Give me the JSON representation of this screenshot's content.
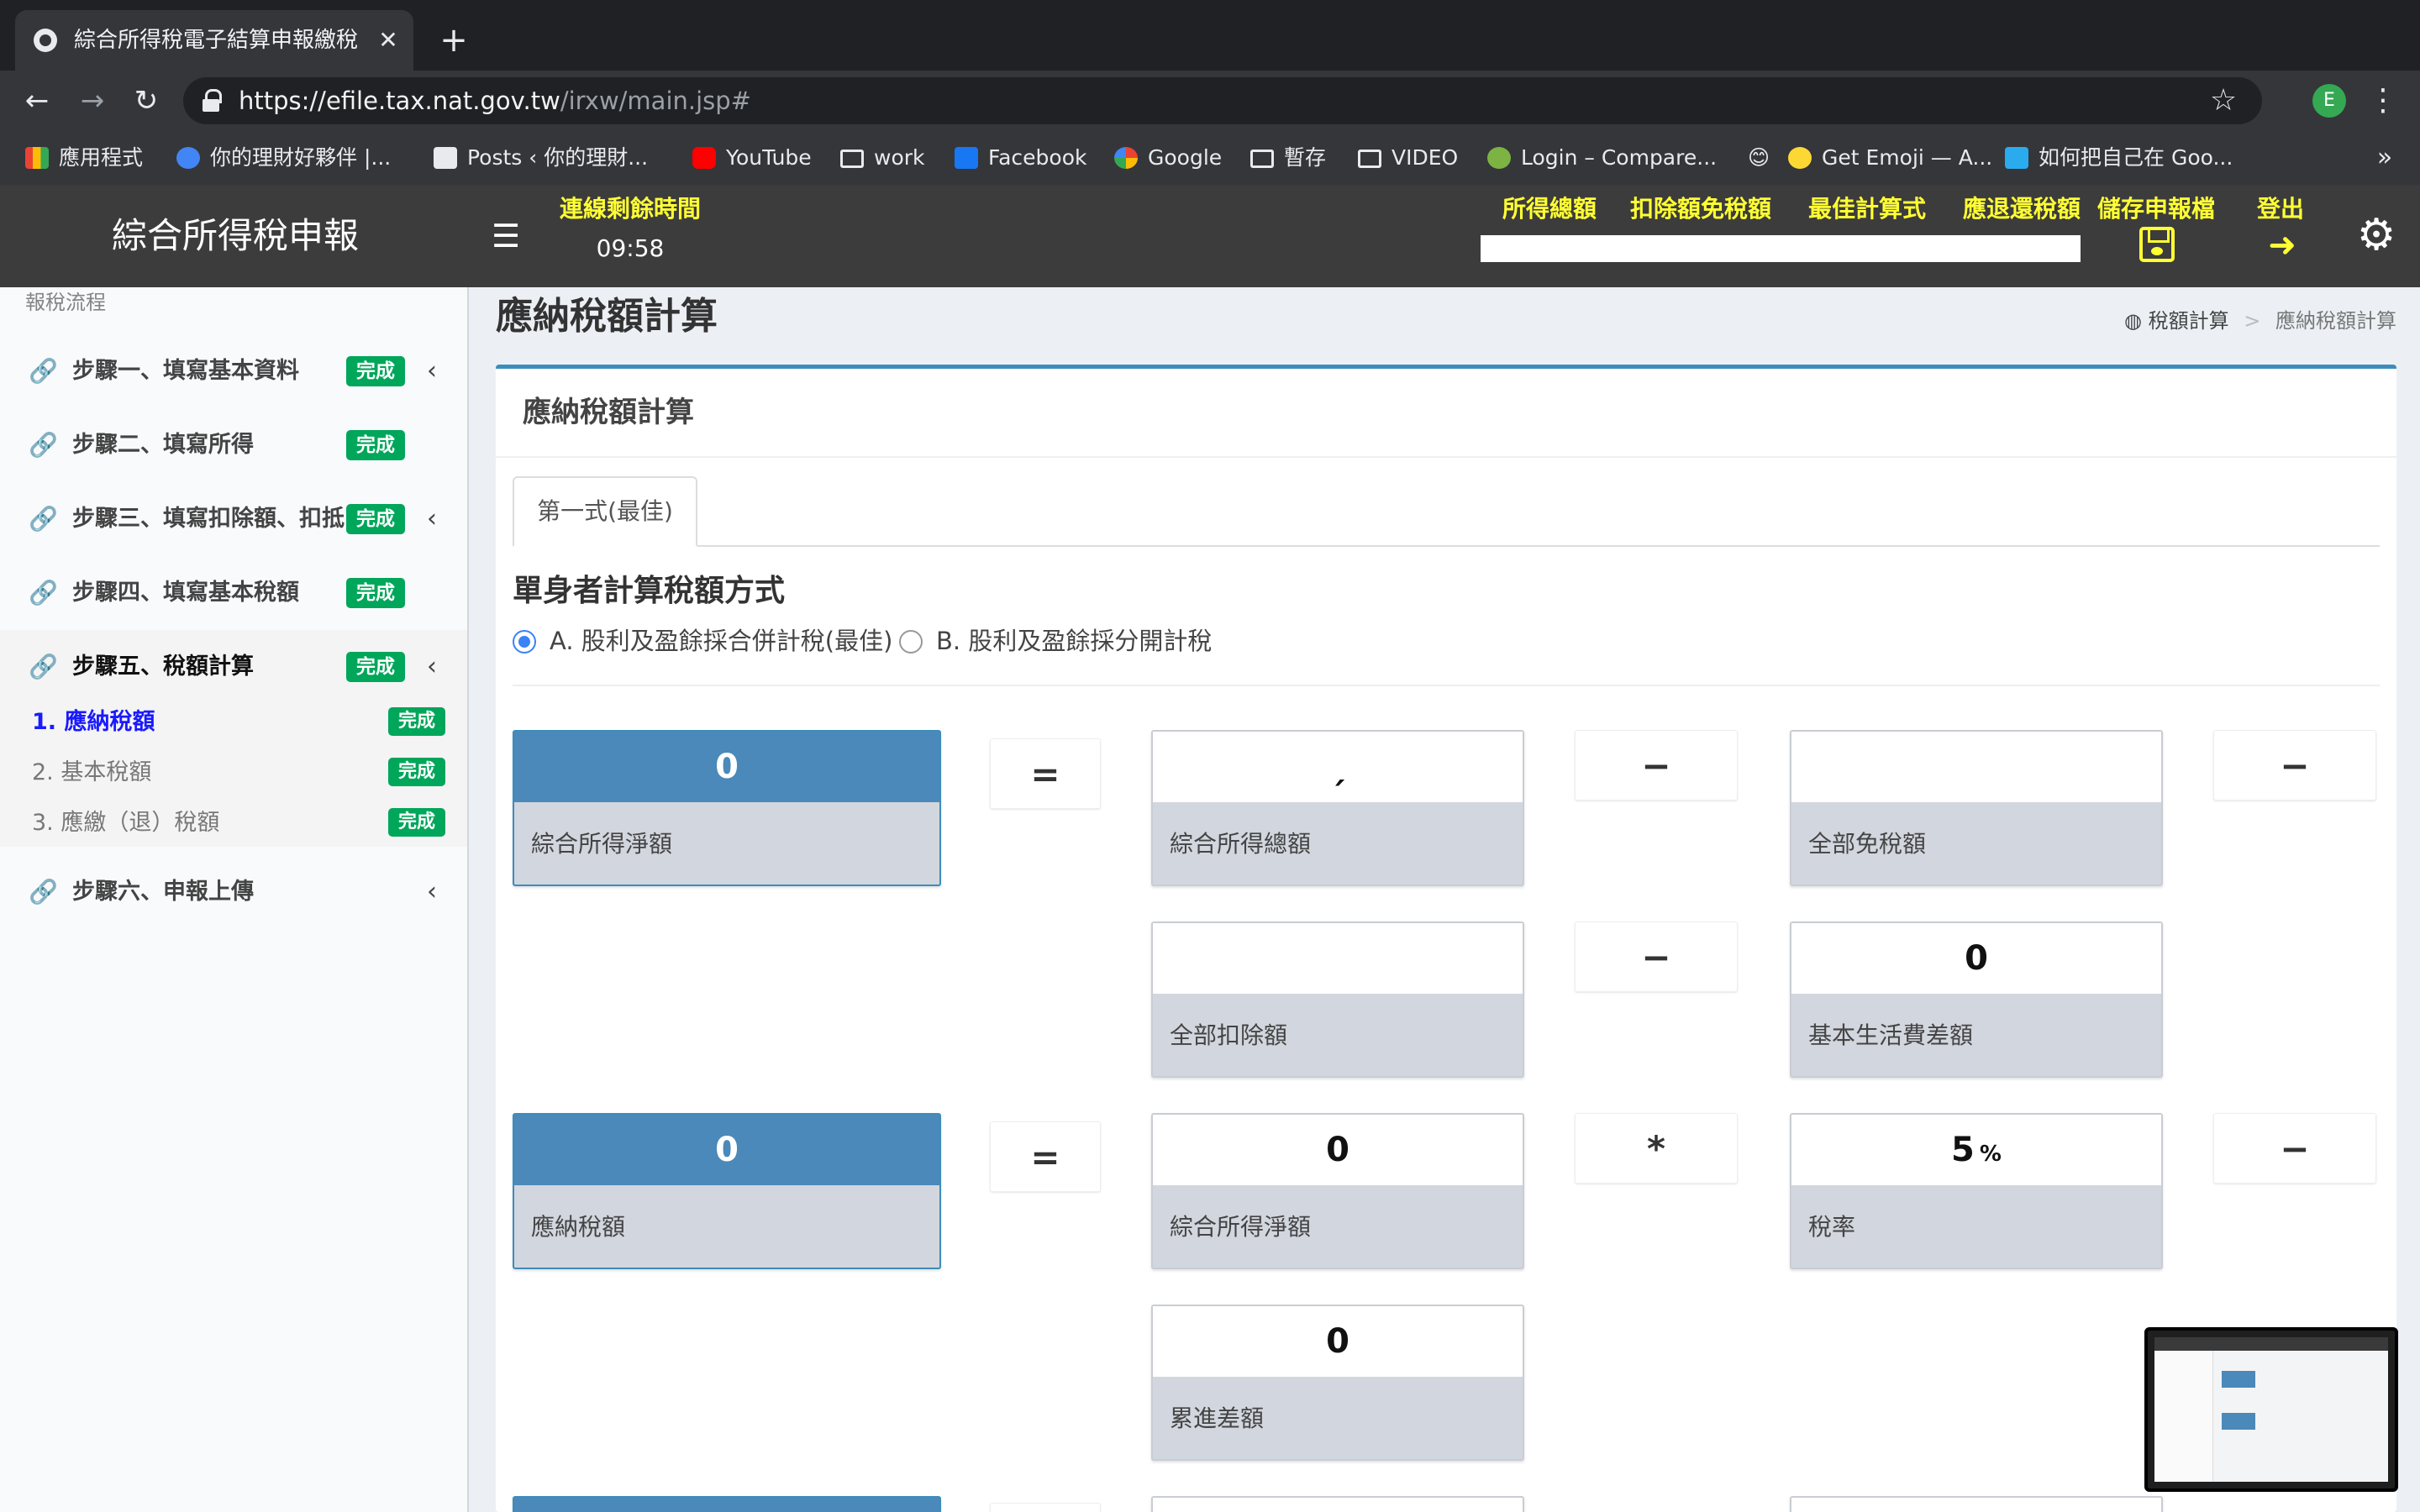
{
  "browser": {
    "tab_title": "綜合所得稅電子結算申報繳稅系統",
    "tab_close": "✕",
    "new_tab": "+",
    "url_host": "https://efile.tax.nat.gov.tw",
    "url_path": "/irxw/main.jsp#",
    "profile_initial": "E",
    "bookmarks": [
      {
        "label": "應用程式",
        "icon": "apps-icon"
      },
      {
        "label": "你的理財好夥伴 |...",
        "icon": "site-icon"
      },
      {
        "label": "Posts ‹ 你的理財...",
        "icon": "posts-icon"
      },
      {
        "label": "YouTube",
        "icon": "youtube-icon"
      },
      {
        "label": "work",
        "icon": "folder-icon"
      },
      {
        "label": "Facebook",
        "icon": "facebook-icon"
      },
      {
        "label": "Google",
        "icon": "google-icon"
      },
      {
        "label": "暫存",
        "icon": "folder-icon"
      },
      {
        "label": "VIDEO",
        "icon": "folder-icon"
      },
      {
        "label": "Login – Compare...",
        "icon": "site-icon"
      },
      {
        "label": "😊",
        "icon": "emoji-icon"
      },
      {
        "label": "Get Emoji — A...",
        "icon": "emoji-icon"
      },
      {
        "label": "如何把自己在 Goo...",
        "icon": "telegram-icon"
      }
    ],
    "bookmarks_overflow": "»"
  },
  "header": {
    "app_title": "綜合所得稅申報",
    "session_label": "連線剩餘時間",
    "session_time": "09:58",
    "links": [
      "所得總額",
      "扣除額免稅額",
      "最佳計算式",
      "應退還稅額"
    ],
    "save_label": "儲存申報檔",
    "logout_label": "登出"
  },
  "sidebar": {
    "heading": "報稅流程",
    "steps": [
      {
        "label": "步驟一、填寫基本資料",
        "badge": "完成"
      },
      {
        "label": "步驟二、填寫所得",
        "badge": "完成"
      },
      {
        "label": "步驟三、填寫扣除額、扣抵",
        "badge": "完成"
      },
      {
        "label": "步驟四、填寫基本稅額",
        "badge": "完成"
      },
      {
        "label": "步驟五、稅額計算",
        "badge": "完成"
      },
      {
        "label": "步驟六、申報上傳",
        "badge": ""
      }
    ],
    "substeps": [
      {
        "label": "1. 應納稅額",
        "badge": "完成"
      },
      {
        "label": "2. 基本稅額",
        "badge": "完成"
      },
      {
        "label": "3. 應繳（退）稅額",
        "badge": "完成"
      }
    ]
  },
  "main": {
    "page_title": "應納稅額計算",
    "breadcrumb_root": "稅額計算",
    "breadcrumb_sep": ">",
    "breadcrumb_current": "應納稅額計算",
    "panel_title": "應納稅額計算",
    "tab_label": "第一式(最佳)",
    "section_title": "單身者計算稅額方式",
    "radio_a": "A. 股利及盈餘採合併計稅(最佳)",
    "radio_b": "B. 股利及盈餘採分開計稅",
    "ops": {
      "equals": "=",
      "minus": "−",
      "times": "*"
    },
    "row1": {
      "net_income": {
        "value": "0",
        "label": "綜合所得淨額"
      },
      "gross_income": {
        "value": "ˏ",
        "label": "綜合所得總額"
      },
      "exemptions": {
        "value": "",
        "label": "全部免稅額"
      }
    },
    "row2": {
      "deductions": {
        "value": "",
        "label": "全部扣除額"
      },
      "living_cost_diff": {
        "value": "0",
        "label": "基本生活費差額"
      }
    },
    "row3": {
      "tax_payable": {
        "value": "0",
        "label": "應納稅額"
      },
      "net_income": {
        "value": "0",
        "label": "綜合所得淨額"
      },
      "tax_rate": {
        "value": "5",
        "unit": "%",
        "label": "稅率"
      }
    },
    "row4": {
      "progressive_diff": {
        "value": "0",
        "label": "累進差額"
      }
    }
  }
}
